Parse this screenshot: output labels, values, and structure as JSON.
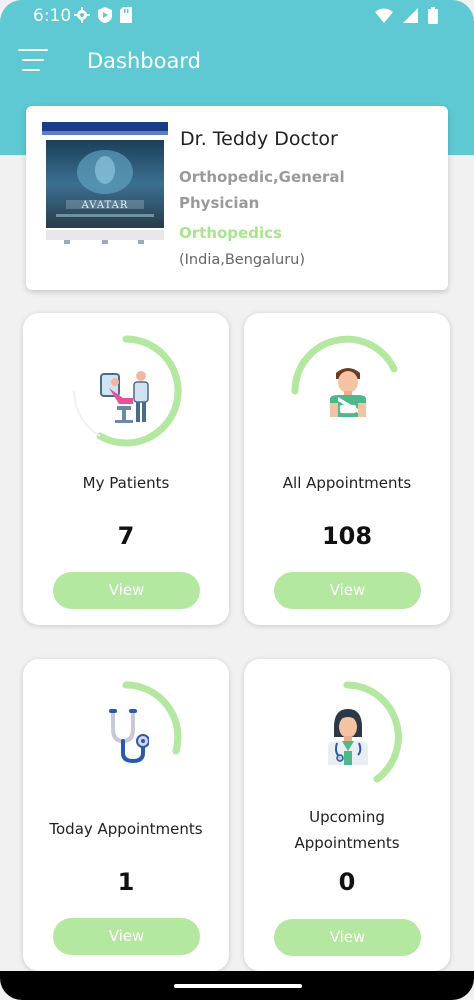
{
  "status_bar": {
    "time": "6:10"
  },
  "app_bar": {
    "title": "Dashboard"
  },
  "profile": {
    "name": "Dr. Teddy Doctor",
    "specialization_line1": "Orthopedic,General",
    "specialization_line2": "Physician",
    "department": "Orthopedics",
    "location": "(India,Bengaluru)",
    "image_caption": "AVATAR"
  },
  "tiles": [
    {
      "label": "My Patients",
      "count": "7",
      "button": "View"
    },
    {
      "label": "All Appointments",
      "count": "108",
      "button": "View"
    },
    {
      "label": "Today Appointments",
      "count": "1",
      "button": "View"
    },
    {
      "label_line1": "Upcoming",
      "label_line2": "Appointments",
      "count": "0",
      "button": "View"
    }
  ],
  "colors": {
    "header": "#5ec9d3",
    "accent_green": "#b4e8a0",
    "department_green": "#a9e58f",
    "ring_green": "#b4e8a0"
  }
}
